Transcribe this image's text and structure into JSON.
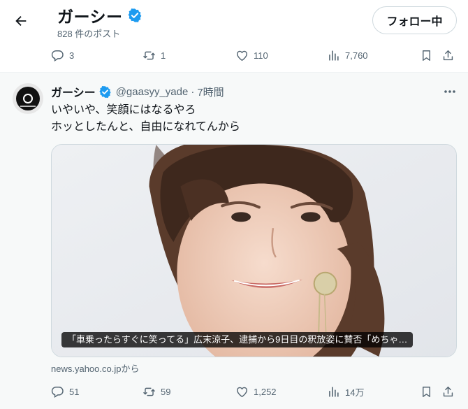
{
  "header": {
    "title": "ガーシー",
    "post_count": "828 件のポスト",
    "follow_label": "フォロー中"
  },
  "prev_post": {
    "replies": "3",
    "reposts": "1",
    "likes": "110",
    "views": "7,760"
  },
  "post": {
    "name": "ガーシー",
    "handle": "@gaasyy_yade",
    "separator": "·",
    "time": "7時間",
    "text_lines": [
      "いやいや、笑顔にはなるやろ",
      "ホッとしたんと、自由になれてんから"
    ],
    "card_caption": "「車乗ったらすぐに笑ってる」広末涼子、逮捕から9日目の釈放姿に賛否「めちゃ…",
    "card_source": "news.yahoo.co.jpから",
    "replies": "51",
    "reposts": "59",
    "likes": "1,252",
    "views": "14万"
  },
  "icons": {
    "back": "arrow-left-icon",
    "verified": "verified-badge-icon",
    "reply": "reply-icon",
    "repost": "repost-icon",
    "like": "heart-icon",
    "views": "views-chart-icon",
    "bookmark": "bookmark-icon",
    "share": "share-icon",
    "more": "more-dots-icon"
  },
  "colors": {
    "verified": "#1d9bf0",
    "text_primary": "#0f1419",
    "text_secondary": "#536471",
    "post_background": "#f7f9f9"
  }
}
